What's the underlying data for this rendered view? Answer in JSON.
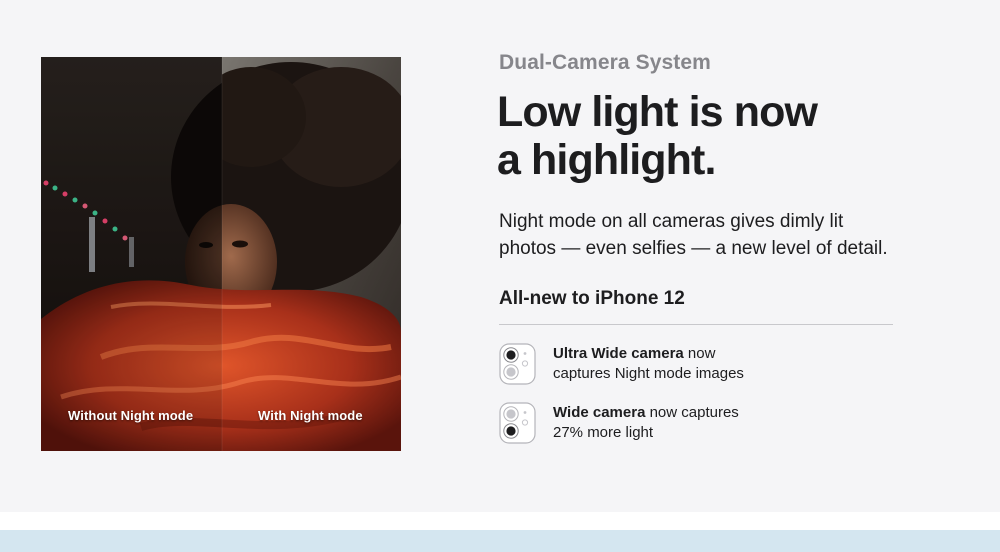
{
  "eyebrow": "Dual-Camera System",
  "headline": {
    "line1": "Low light is now",
    "line2": "a highlight."
  },
  "body": {
    "line1": "Night mode on all cameras gives dimly lit",
    "line2": "photos — even selfies — a new level of detail."
  },
  "subhead": "All-new to iPhone 12",
  "photo": {
    "caption_left": "Without Night mode",
    "caption_right": "With Night mode"
  },
  "features": [
    {
      "icon": "dual-camera-icon-top-lens",
      "bold": "Ultra Wide camera",
      "rest1": " now",
      "rest2": "captures Night mode images"
    },
    {
      "icon": "dual-camera-icon-bottom-lens",
      "bold": "Wide camera",
      "rest1": " now captures",
      "rest2": "27% more light"
    }
  ],
  "colors": {
    "background": "#f5f5f7",
    "eyebrow": "#86868b",
    "text": "#1d1d1f",
    "rule": "#c8c8cc",
    "bottom_strip": "#d4e6f0"
  }
}
